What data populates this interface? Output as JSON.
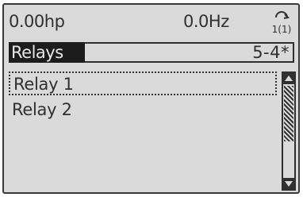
{
  "status": {
    "power": "0.00hp",
    "frequency": "0.0Hz",
    "setup_icon": "active-setup-icon",
    "setup_label": "1(1)"
  },
  "title": {
    "label": "Relays",
    "code": "5-4*"
  },
  "list": {
    "items": [
      {
        "label": "Relay 1",
        "selected": true
      },
      {
        "label": "Relay 2",
        "selected": false
      }
    ]
  },
  "scrollbar": {
    "up_icon": "scroll-up-arrow-icon",
    "down_icon": "scroll-down-arrow-icon"
  },
  "colors": {
    "screen_bg": "#dadada",
    "text": "#303030",
    "title_fill": "#1c1c1c"
  }
}
